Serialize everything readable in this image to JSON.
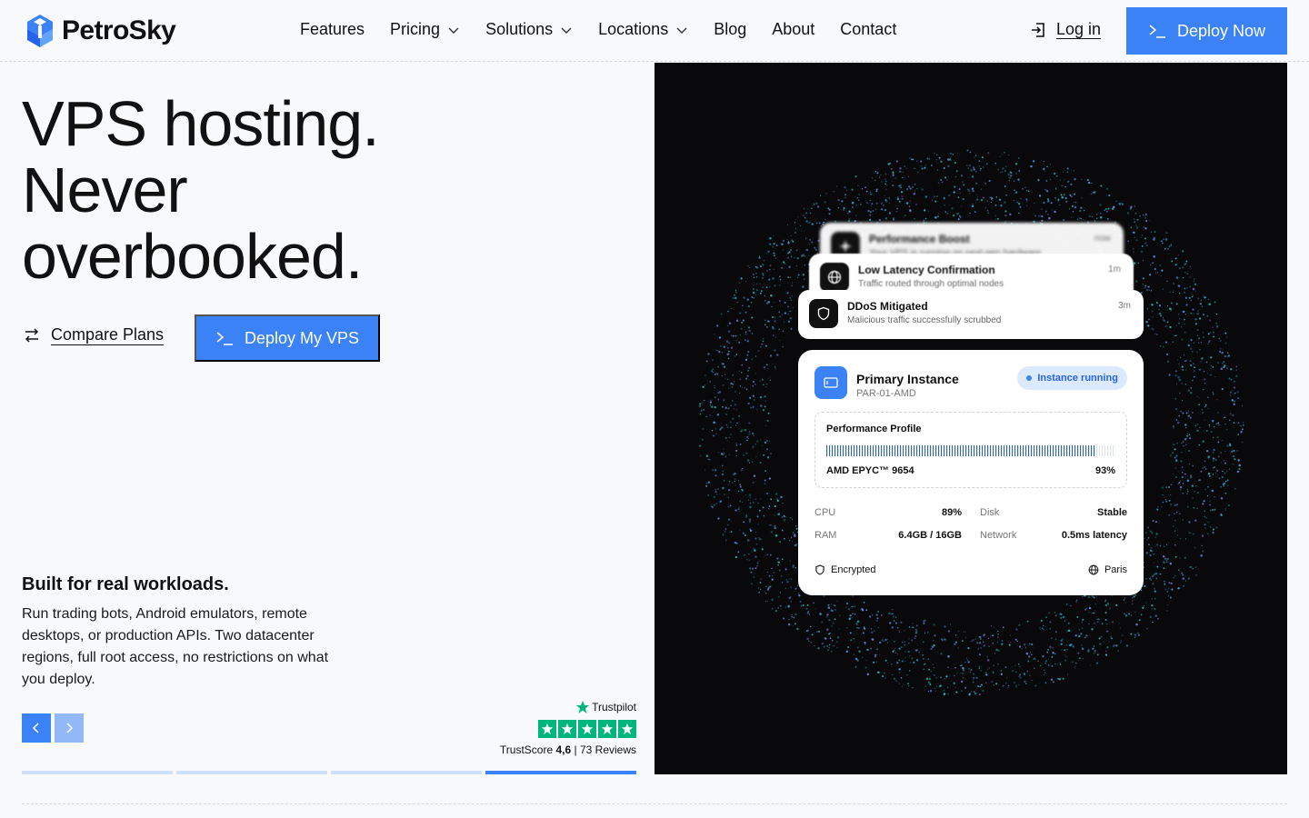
{
  "brand": {
    "name": "PetroSky",
    "accent": "#3b82f6",
    "accent_light": "#93b8f8"
  },
  "nav": {
    "items": [
      {
        "label": "Features",
        "dropdown": false
      },
      {
        "label": "Pricing",
        "dropdown": true
      },
      {
        "label": "Solutions",
        "dropdown": true
      },
      {
        "label": "Locations",
        "dropdown": true
      },
      {
        "label": "Blog",
        "dropdown": false
      },
      {
        "label": "About",
        "dropdown": false
      },
      {
        "label": "Contact",
        "dropdown": false
      }
    ],
    "login_label": "Log in",
    "deploy_label": "Deploy Now"
  },
  "hero": {
    "title_lines": [
      "VPS hosting.",
      "Never",
      "overbooked."
    ],
    "compare_label": "Compare Plans",
    "deploy_label": "Deploy My VPS"
  },
  "feature": {
    "title": "Built for real workloads.",
    "description": "Run trading bots, Android emulators, remote desktops, or production APIs. Two datacenter regions, full root access, no restrictions on what you deploy.",
    "slides_total": 4,
    "active_slide": 4
  },
  "trustpilot": {
    "label": "Trustpilot",
    "score_label": "TrustScore",
    "score": "4,6",
    "reviews": "73 Reviews",
    "stars": 5
  },
  "notifications": [
    {
      "title": "Performance Boost",
      "subtitle": "Your VPS is running on next-gen hardware",
      "time": "now",
      "icon": "sparkle-icon"
    },
    {
      "title": "Low Latency Confirmation",
      "subtitle": "Traffic routed through optimal nodes",
      "time": "1m",
      "icon": "globe-icon"
    },
    {
      "title": "DDoS Mitigated",
      "subtitle": "Malicious traffic successfully scrubbed",
      "time": "3m",
      "icon": "shield-icon"
    }
  ],
  "instance": {
    "title": "Primary Instance",
    "id": "PAR-01-AMD",
    "status": "Instance running",
    "perf_label": "Performance Profile",
    "cpu_model": "AMD EPYC™ 9654",
    "perf_percent": "93%",
    "perf_fraction": 0.93,
    "stats": [
      {
        "k1": "CPU",
        "v1": "89%",
        "k2": "Disk",
        "v2": "Stable"
      },
      {
        "k1": "RAM",
        "v1": "6.4GB / 16GB",
        "k2": "Network",
        "v2": "0.5ms latency"
      }
    ],
    "foot_left": "Encrypted",
    "foot_right": "Paris"
  }
}
